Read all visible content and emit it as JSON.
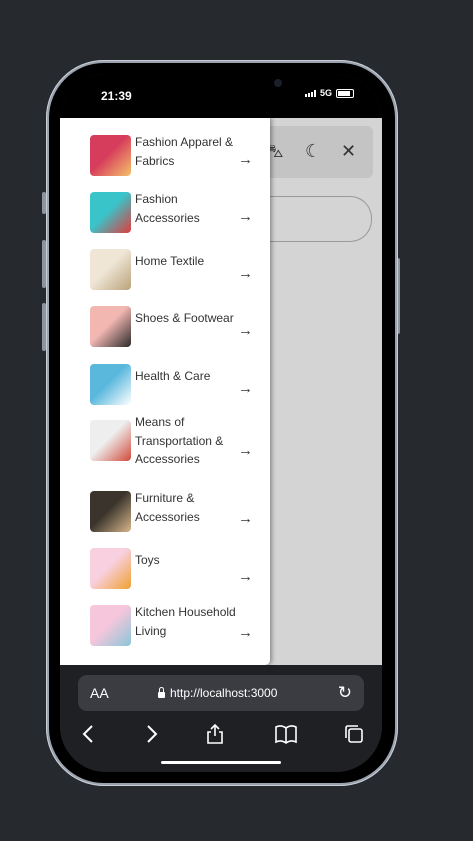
{
  "status_bar": {
    "time": "21:39",
    "network": "5G",
    "signal_icon": "signal-bars-icon",
    "battery_icon": "battery-icon"
  },
  "header": {
    "icons": [
      "basket-icon",
      "moon-star-icon",
      "close-icon"
    ],
    "glyphs": {
      "basket": "⛍",
      "moon": "☾",
      "close": "✕"
    }
  },
  "drawer": {
    "arrow_glyph": "→",
    "categories": [
      {
        "label": "Fashion Apparel & Fabrics",
        "colors": [
          "#d63c5c",
          "#f4c26a"
        ]
      },
      {
        "label": "Fashion Accessories",
        "colors": [
          "#38c4c9",
          "#e23b3b"
        ]
      },
      {
        "label": "Home Textile",
        "colors": [
          "#efe6d6",
          "#b9a27a"
        ]
      },
      {
        "label": "Shoes & Footwear",
        "colors": [
          "#f3b7b2",
          "#2a2a2a"
        ]
      },
      {
        "label": "Health & Care",
        "colors": [
          "#5ab8dd",
          "#ffffff"
        ]
      },
      {
        "label": "Means of Transportation & Accessories",
        "colors": [
          "#eeeeee",
          "#d04a3a"
        ]
      },
      {
        "label": "Furniture & Accessories",
        "colors": [
          "#3a342c",
          "#d8b78b"
        ]
      },
      {
        "label": "Toys",
        "colors": [
          "#f8d0e0",
          "#f0a030"
        ]
      },
      {
        "label": "Kitchen Household Living",
        "colors": [
          "#f6c6dc",
          "#8cc6d8"
        ]
      }
    ]
  },
  "browser": {
    "text_size_label": "AA",
    "url": "http://localhost:3000",
    "icons": {
      "lock": "lock-icon",
      "reload": "reload-icon"
    },
    "glyphs": {
      "reload": "↻",
      "back": "‹",
      "forward": "›"
    }
  }
}
